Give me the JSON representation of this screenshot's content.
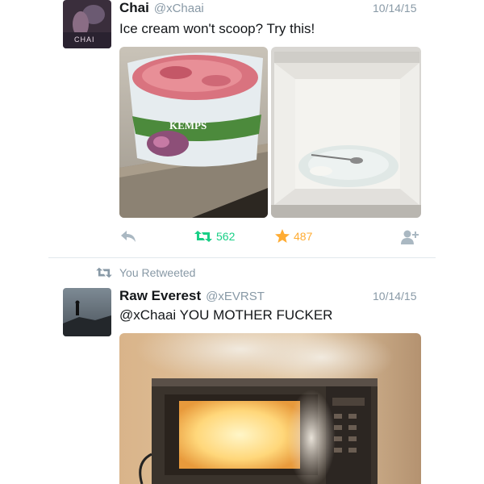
{
  "tweet1": {
    "name": "Chai",
    "handle": "@xChaai",
    "date": "10/14/15",
    "text": "Ice cream won't scoop? Try this!",
    "avatar_text": "CHAI",
    "media": {
      "left_image": "ice-cream-tub-photo",
      "right_image": "microwave-plate-photo",
      "tub_brand": "KEMPS"
    },
    "actions": {
      "retweets": "562",
      "likes": "487",
      "retweet_color": "#19cf86",
      "like_color": "#ffac33"
    }
  },
  "retweet_notice": "You Retweeted",
  "tweet2": {
    "name": "Raw Everest",
    "handle": "@xEVRST",
    "date": "10/14/15",
    "text": "@xChaai YOU MOTHER FUCKER",
    "media": {
      "image": "burning-microwave-photo"
    }
  },
  "colors": {
    "muted": "#8899a6",
    "text": "#14171a"
  }
}
